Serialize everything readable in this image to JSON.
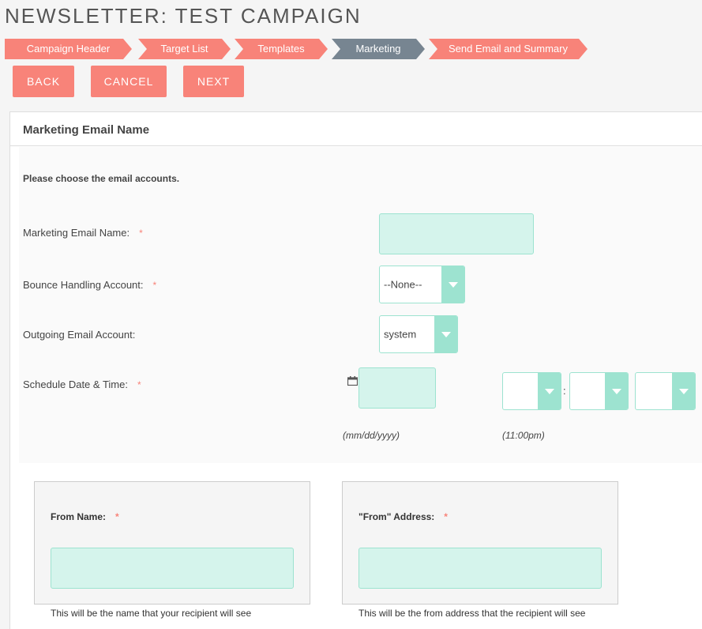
{
  "page_title": "NEWSLETTER: TEST CAMPAIGN",
  "steps": [
    {
      "label": "Campaign Header"
    },
    {
      "label": "Target List"
    },
    {
      "label": "Templates"
    },
    {
      "label": "Marketing"
    },
    {
      "label": "Send Email and Summary"
    }
  ],
  "active_step": "Marketing",
  "actions": {
    "back": "BACK",
    "cancel": "CANCEL",
    "next": "NEXT"
  },
  "panel": {
    "header": "Marketing Email Name",
    "intro": "Please choose the email accounts."
  },
  "form": {
    "marketing_email_name": {
      "label": "Marketing Email Name:",
      "required": "*",
      "value": ""
    },
    "bounce_account": {
      "label": "Bounce Handling Account:",
      "required": "*",
      "selected": "--None--"
    },
    "outgoing_account": {
      "label": "Outgoing Email Account:",
      "selected": "system"
    },
    "schedule": {
      "label": "Schedule Date & Time:",
      "required": "*",
      "date_value": "",
      "date_hint": "(mm/dd/yyyy)",
      "time_separator": ":",
      "time_hint": "(11:00pm)",
      "hour": "",
      "minute": "",
      "meridiem": ""
    }
  },
  "from_name": {
    "label": "From Name:",
    "required": "*",
    "value": "",
    "help": "This will be the name that your recipient will see"
  },
  "from_address": {
    "label": "\"From\" Address:",
    "required": "*",
    "value": "",
    "help": "This will be the from address that the recipient will see"
  },
  "colors": {
    "accent": "#f88379",
    "active_step": "#778591",
    "input_fill": "#d5f4ec",
    "input_border": "#9de3d0"
  }
}
